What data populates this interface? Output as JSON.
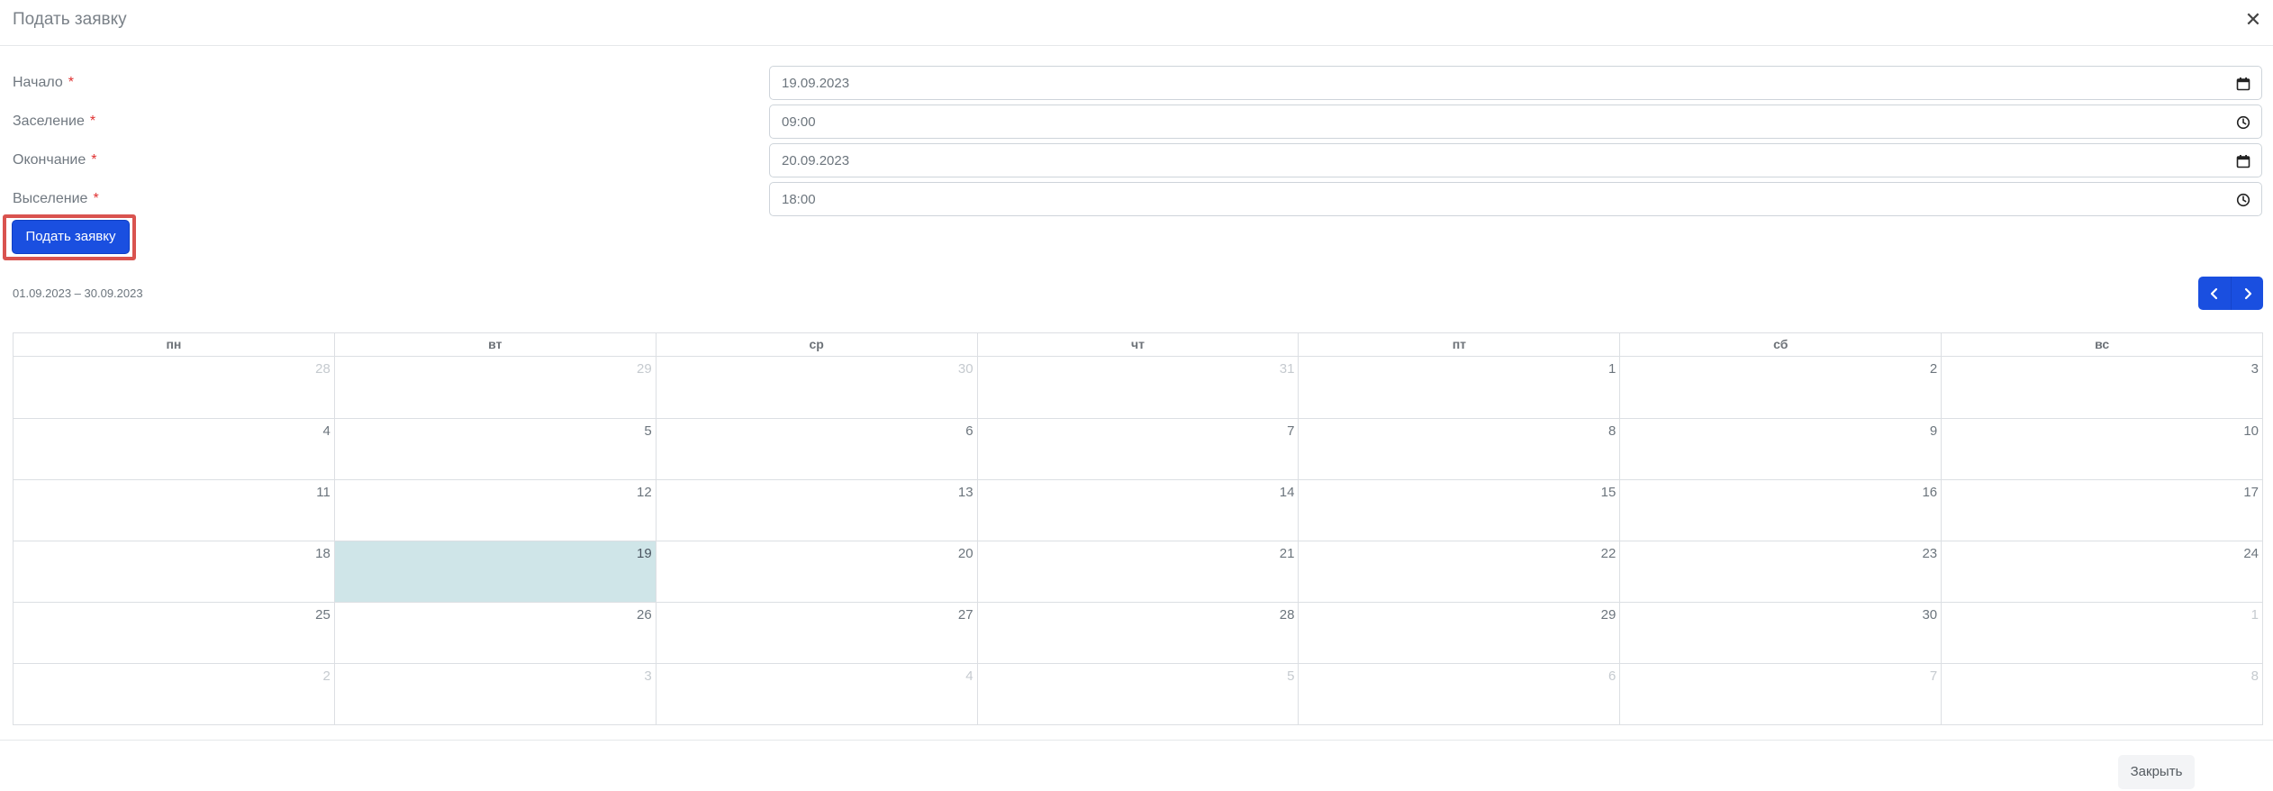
{
  "modal": {
    "title": "Подать заявку",
    "close_icon": "close-icon"
  },
  "form": {
    "fields": [
      {
        "label": "Начало",
        "required": "*",
        "value": "19.09.2023",
        "icon": "calendar-icon"
      },
      {
        "label": "Заселение",
        "required": "*",
        "value": "09:00",
        "icon": "clock-icon"
      },
      {
        "label": "Окончание",
        "required": "*",
        "value": "20.09.2023",
        "icon": "calendar-icon"
      },
      {
        "label": "Выселение",
        "required": "*",
        "value": "18:00",
        "icon": "clock-icon"
      }
    ],
    "submit_label": "Подать заявку"
  },
  "calendar": {
    "range": "01.09.2023 – 30.09.2023",
    "prev_icon": "chevron-left-icon",
    "next_icon": "chevron-right-icon",
    "weekdays": [
      "пн",
      "вт",
      "ср",
      "чт",
      "пт",
      "сб",
      "вс"
    ],
    "weeks": [
      [
        "28",
        "29",
        "30",
        "31",
        "1",
        "2",
        "3"
      ],
      [
        "4",
        "5",
        "6",
        "7",
        "8",
        "9",
        "10"
      ],
      [
        "11",
        "12",
        "13",
        "14",
        "15",
        "16",
        "17"
      ],
      [
        "18",
        "19",
        "20",
        "21",
        "22",
        "23",
        "24"
      ],
      [
        "25",
        "26",
        "27",
        "28",
        "29",
        "30",
        "1"
      ],
      [
        "2",
        "3",
        "4",
        "5",
        "6",
        "7",
        "8"
      ]
    ],
    "today": "19",
    "colors": {
      "today_bg": "#cfe5e8",
      "accent": "#1a4fe0"
    }
  },
  "footer": {
    "close_label": "Закрыть"
  }
}
